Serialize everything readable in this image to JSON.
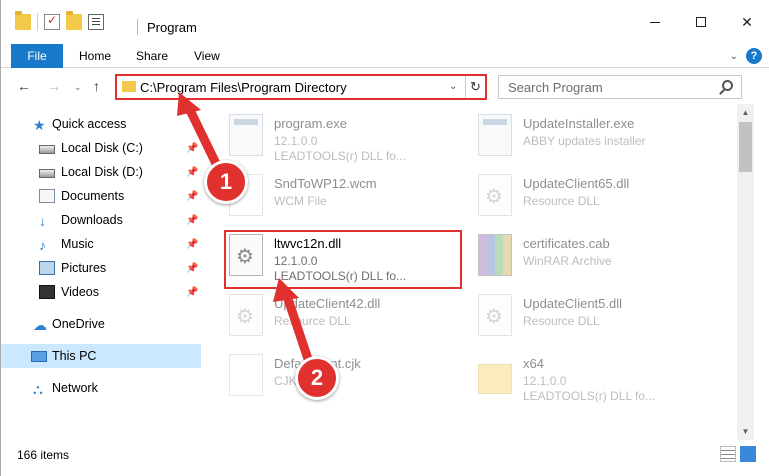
{
  "window": {
    "title": "Program",
    "min_icon": "minimize-icon",
    "max_icon": "maximize-icon",
    "close_glyph": "✕"
  },
  "ribbon": {
    "tabs": [
      {
        "label": "File"
      },
      {
        "label": "Home"
      },
      {
        "label": "Share"
      },
      {
        "label": "View"
      }
    ],
    "collapse_glyph": "⌄",
    "help_glyph": "?"
  },
  "nav": {
    "back_glyph": "←",
    "forward_glyph": "→",
    "recent_glyph": "⌄",
    "up_glyph": "↑",
    "address": "C:\\Program Files\\Program Directory",
    "address_drop_glyph": "⌄",
    "refresh_glyph": "↻",
    "search_placeholder": "Search Program"
  },
  "sidebar": {
    "items": [
      {
        "label": "Quick access",
        "icon": "star-icon",
        "glyph": "★",
        "pinned": false
      },
      {
        "label": "Local Disk (C:)",
        "icon": "drive-icon",
        "glyph": "",
        "pinned": true
      },
      {
        "label": "Local Disk (D:)",
        "icon": "drive-icon",
        "glyph": "",
        "pinned": true
      },
      {
        "label": "Documents",
        "icon": "documents-icon",
        "glyph": "",
        "pinned": true
      },
      {
        "label": "Downloads",
        "icon": "download-icon",
        "glyph": "↓",
        "pinned": true
      },
      {
        "label": "Music",
        "icon": "music-icon",
        "glyph": "♪",
        "pinned": true
      },
      {
        "label": "Pictures",
        "icon": "pictures-icon",
        "glyph": "",
        "pinned": true
      },
      {
        "label": "Videos",
        "icon": "videos-icon",
        "glyph": "",
        "pinned": true
      },
      {
        "label": "OneDrive",
        "icon": "cloud-icon",
        "glyph": "☁",
        "pinned": false
      },
      {
        "label": "This PC",
        "icon": "computer-icon",
        "glyph": "",
        "pinned": false,
        "selected": true
      },
      {
        "label": "Network",
        "icon": "network-icon",
        "glyph": "⛬",
        "pinned": false
      }
    ],
    "pin_glyph": "📌"
  },
  "files": [
    {
      "name": "program.exe",
      "line2": "12.1.0.0",
      "line3": "LEADTOOLS(r) DLL fo...",
      "icon": "exe-icon",
      "faded": true
    },
    {
      "name": "UpdateInstaller.exe",
      "line2": "ABBY updates installer",
      "line3": "",
      "icon": "exe-icon",
      "faded": true
    },
    {
      "name": "SndToWP12.wcm",
      "line2": "WCM File",
      "line3": "",
      "icon": "file-icon",
      "faded": true
    },
    {
      "name": "UpdateClient65.dll",
      "line2": "Resource DLL",
      "line3": "",
      "icon": "dll-icon",
      "faded": true
    },
    {
      "name": "ltwvc12n.dll",
      "line2": "12.1.0.0",
      "line3": "LEADTOOLS(r) DLL fo...",
      "icon": "dll-icon",
      "faded": false
    },
    {
      "name": "certificates.cab",
      "line2": "WinRAR Archive",
      "line3": "",
      "icon": "archive-icon",
      "faded": true
    },
    {
      "name": "UpdateClient42.dll",
      "line2": "Resource DLL",
      "line3": "",
      "icon": "dll-icon",
      "faded": true
    },
    {
      "name": "UpdateClient5.dll",
      "line2": "Resource DLL",
      "line3": "",
      "icon": "dll-icon",
      "faded": true
    },
    {
      "name": "DefaultFont.cjk",
      "line2": "CJK File",
      "line3": "",
      "icon": "file-icon",
      "faded": true
    },
    {
      "name": "x64",
      "line2": "12.1.0.0",
      "line3": "LEADTOOLS(r) DLL fo...",
      "icon": "folder-icon",
      "faded": true
    }
  ],
  "scrollbar": {
    "up_glyph": "▲",
    "down_glyph": "▼"
  },
  "status": {
    "item_count": "166 items"
  },
  "callouts": {
    "step1": "1",
    "step2": "2"
  },
  "colors": {
    "accent": "#1979ca",
    "highlight": "#e0312f"
  }
}
